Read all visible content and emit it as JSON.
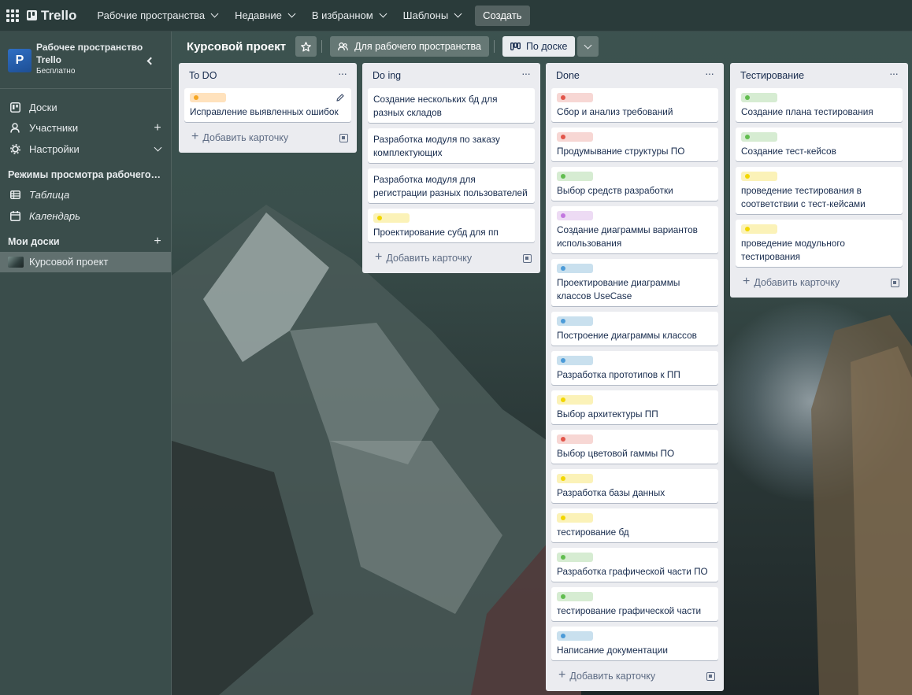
{
  "topbar": {
    "logo": "Trello",
    "nav": [
      {
        "label": "Рабочие пространства"
      },
      {
        "label": "Недавние"
      },
      {
        "label": "В избранном"
      },
      {
        "label": "Шаблоны"
      }
    ],
    "create_label": "Создать"
  },
  "sidebar": {
    "workspace_initial": "P",
    "workspace_name": "Рабочее пространство Trello",
    "workspace_plan": "Бесплатно",
    "items": [
      {
        "label": "Доски"
      },
      {
        "label": "Участники"
      },
      {
        "label": "Настройки"
      }
    ],
    "views_header": "Режимы просмотра рабочего прос...",
    "views": [
      {
        "label": "Таблица"
      },
      {
        "label": "Календарь"
      }
    ],
    "my_boards_header": "Мои доски",
    "boards": [
      {
        "label": "Курсовой проект"
      }
    ]
  },
  "board": {
    "title": "Курсовой проект",
    "visibility_label": "Для рабочего пространства",
    "view_label": "По доске",
    "add_card_label": "Добавить карточку",
    "lists": [
      {
        "title": "To DO",
        "cards": [
          {
            "label": "orange",
            "text": "Исправление выявленных ошибок"
          }
        ]
      },
      {
        "title": "Do ing",
        "cards": [
          {
            "label": null,
            "text": "Создание нескольких бд для разных складов"
          },
          {
            "label": null,
            "text": "Разработка модуля по заказу комплектующих"
          },
          {
            "label": null,
            "text": "Разработка модуля для регистрации разных пользователей"
          },
          {
            "label": "yellow",
            "text": "Проектирование субд для пп"
          }
        ]
      },
      {
        "title": "Done",
        "cards": [
          {
            "label": "red",
            "text": "Сбор и анализ требований"
          },
          {
            "label": "red",
            "text": "Продумывание структуры ПО"
          },
          {
            "label": "green",
            "text": "Выбор средств разработки"
          },
          {
            "label": "purple",
            "text": "Создание диаграммы вариантов использования"
          },
          {
            "label": "blue",
            "text": "Проектирование диаграммы классов UseCase"
          },
          {
            "label": "blue",
            "text": "Построение диаграммы классов"
          },
          {
            "label": "blue",
            "text": "Разработка прототипов к ПП"
          },
          {
            "label": "yellow",
            "text": "Выбор архитектуры ПП"
          },
          {
            "label": "red",
            "text": "Выбор цветовой гаммы ПО"
          },
          {
            "label": "yellow",
            "text": "Разработка базы данных"
          },
          {
            "label": "yellow",
            "text": "тестирование бд"
          },
          {
            "label": "green",
            "text": "Разработка графической части ПО"
          },
          {
            "label": "green",
            "text": "тестирование графической части"
          },
          {
            "label": "blue",
            "text": "Написание документации"
          }
        ]
      },
      {
        "title": "Тестирование",
        "cards": [
          {
            "label": "green",
            "text": "Создание плана тестирования"
          },
          {
            "label": "green",
            "text": "Создание тест-кейсов"
          },
          {
            "label": "yellow",
            "text": "проведение тестирования в соответствии с тест-кейсами"
          },
          {
            "label": "yellow",
            "text": "проведение модульного тестирования"
          }
        ]
      }
    ]
  },
  "colors": {
    "topbar": "#2a3b3a",
    "sidebar": "#3a4d4b",
    "list_bg": "#ebecf0",
    "label_orange": "#f5a623",
    "label_red": "#e2554a",
    "label_green": "#61bd4f",
    "label_yellow": "#f2d600",
    "label_purple": "#c377e0",
    "label_blue": "#4c9bd8"
  }
}
